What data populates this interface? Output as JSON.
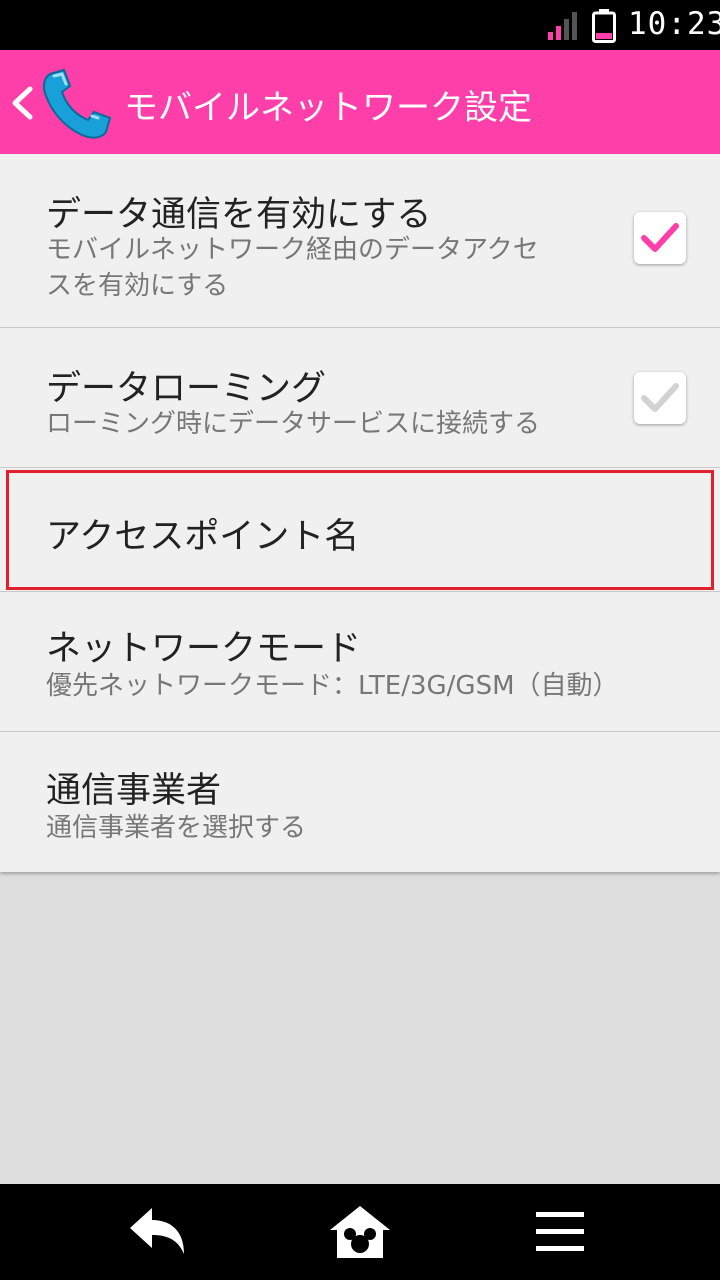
{
  "status_bar": {
    "time": "10:23"
  },
  "app_bar": {
    "title": "モバイルネットワーク設定"
  },
  "settings": [
    {
      "title": "データ通信を有効にする",
      "subtitle_lines": [
        "モバイルネットワーク経由のデータアクセ",
        "スを有効にする"
      ],
      "checked": true
    },
    {
      "title": "データローミング",
      "subtitle_lines": [
        "ローミング時にデータサービスに接続する"
      ],
      "checked": false
    },
    {
      "title": "アクセスポイント名"
    },
    {
      "title": "ネットワークモード",
      "subtitle_lines": [
        "優先ネットワークモード：LTE/3G/GSM（自動）"
      ]
    },
    {
      "title": "通信事業者",
      "subtitle_lines": [
        "通信事業者を選択する"
      ]
    }
  ],
  "colors": {
    "accent": "#ff3fa9",
    "highlight": "#e0202c"
  }
}
